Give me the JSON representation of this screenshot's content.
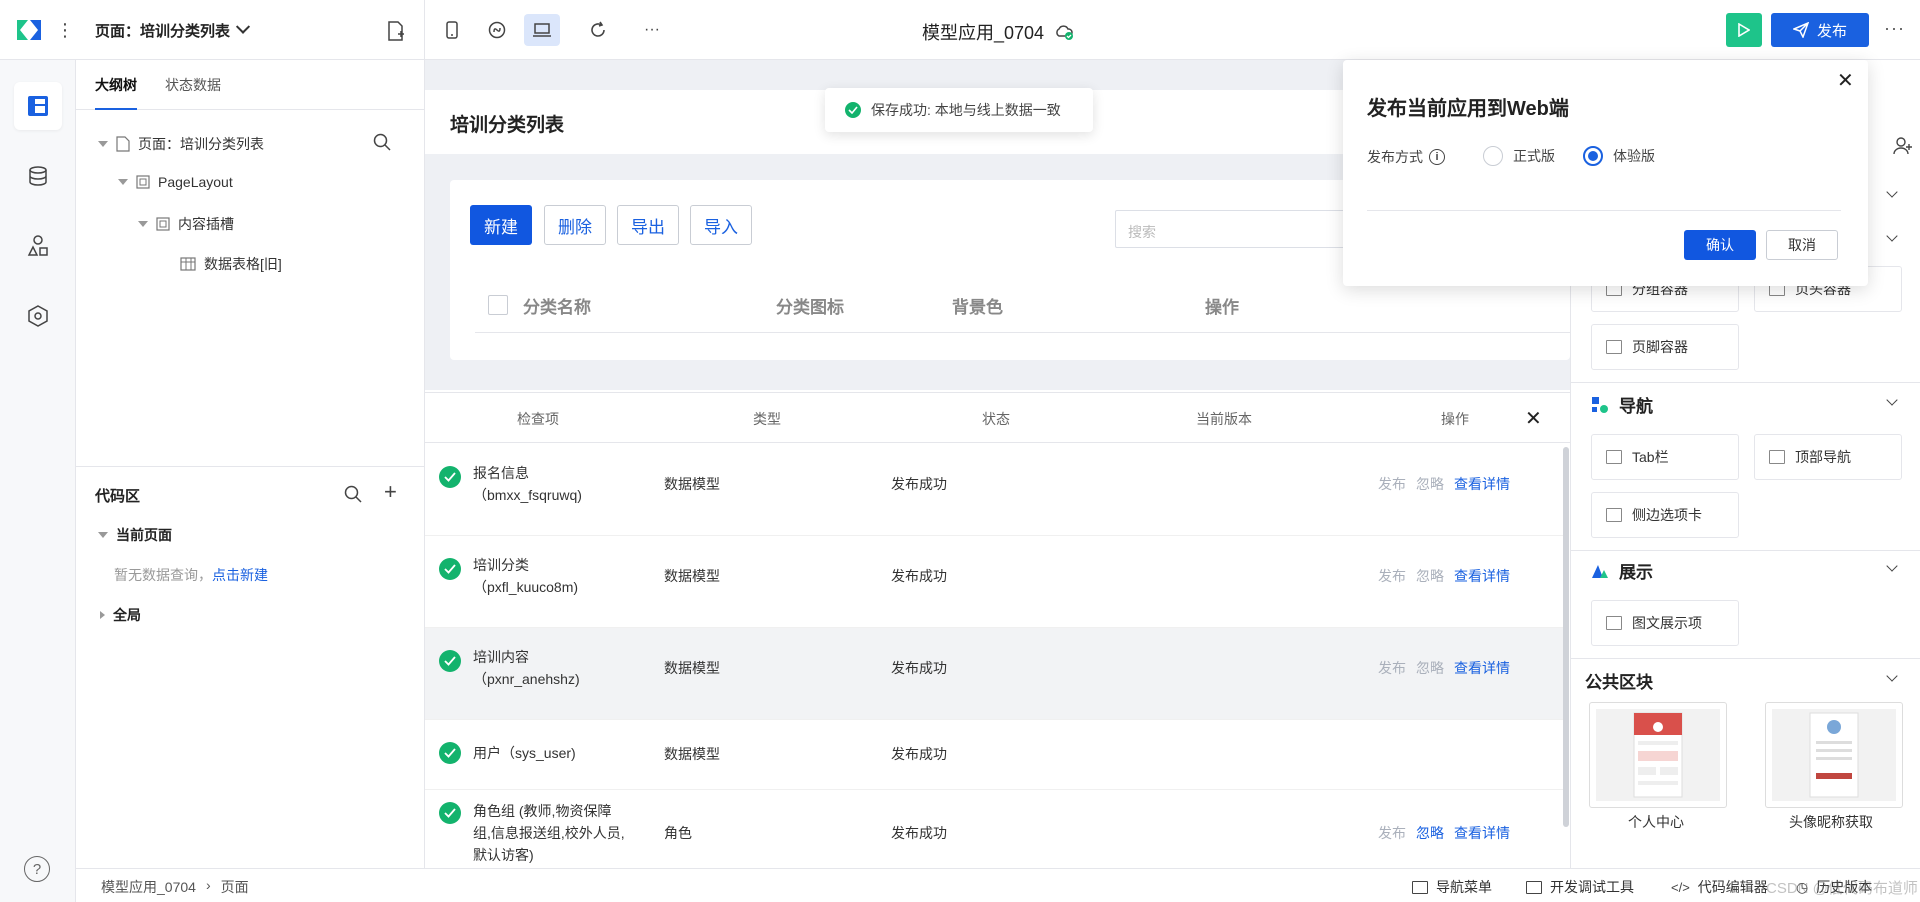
{
  "topbar": {
    "page_select": "页面：培训分类列表",
    "app_title": "模型应用_0704",
    "publish_label": "发布",
    "more": "···"
  },
  "outline": {
    "tabs": [
      "大纲树",
      "状态数据"
    ],
    "tree": [
      {
        "label": "页面：培训分类列表"
      },
      {
        "label": "PageLayout"
      },
      {
        "label": "内容插槽"
      },
      {
        "label": "数据表格[旧]"
      }
    ],
    "code": {
      "title": "代码区",
      "current_page": "当前页面",
      "empty_text": "暂无数据查询，",
      "create_link": "点击新建",
      "global": "全局"
    }
  },
  "canvas": {
    "page_title": "培训分类列表",
    "buttons": {
      "create": "新建",
      "delete": "删除",
      "export": "导出",
      "import": "导入"
    },
    "search_placeholder": "搜索",
    "columns": [
      "分类名称",
      "分类图标",
      "背景色",
      "操作"
    ]
  },
  "toast": {
    "text": "保存成功: 本地与线上数据一致"
  },
  "check_panel": {
    "headers": [
      "检查项",
      "类型",
      "状态",
      "当前版本",
      "操作"
    ],
    "rows": [
      {
        "name1": "报名信息",
        "name2": "（bmxx_fsqruwq)",
        "type": "数据模型",
        "status": "发布成功",
        "ops": [
          "发布",
          "忽略",
          "查看详情"
        ]
      },
      {
        "name1": "培训分类",
        "name2": "（pxfl_kuuco8m)",
        "type": "数据模型",
        "status": "发布成功",
        "ops": [
          "发布",
          "忽略",
          "查看详情"
        ]
      },
      {
        "name1": "培训内容",
        "name2": "（pxnr_anehshz)",
        "type": "数据模型",
        "status": "发布成功",
        "ops": [
          "发布",
          "忽略",
          "查看详情"
        ]
      },
      {
        "name1": "用户（sys_user)",
        "name2": "",
        "type": "数据模型",
        "status": "发布成功",
        "ops": []
      },
      {
        "name1": "角色组 (教师,物资保障",
        "name2": "组,信息报送组,校外人员,",
        "name3": "默认访客)",
        "type": "角色",
        "status": "发布成功",
        "ops": [
          "发布",
          "忽略",
          "查看详情"
        ]
      }
    ]
  },
  "components": {
    "layout_items": [
      "分组容器",
      "页头容器",
      "页脚容器"
    ],
    "nav_title": "导航",
    "nav_items": [
      "Tab栏",
      "顶部导航",
      "侧边选项卡"
    ],
    "display_title": "展示",
    "display_items": [
      "图文展示项"
    ],
    "public_title": "公共区块",
    "public_blocks": [
      "个人中心",
      "头像昵称获取"
    ]
  },
  "dialog": {
    "title": "发布当前应用到Web端",
    "method_label": "发布方式",
    "options": [
      "正式版",
      "体验版"
    ],
    "selected": "体验版",
    "confirm": "确认",
    "cancel": "取消"
  },
  "statusbar": {
    "crumbs": [
      "模型应用_0704",
      "页面"
    ],
    "items": [
      "导航菜单",
      "开发调试工具",
      "代码编辑器",
      "历史版本"
    ],
    "watermark": "CSDN @低代码布道师"
  },
  "colors": {
    "primary": "#1a61e0",
    "success": "#13b36d",
    "run": "#1ec48a"
  }
}
